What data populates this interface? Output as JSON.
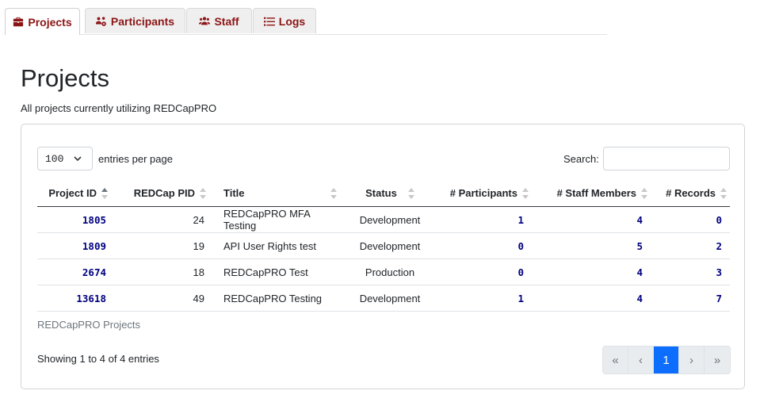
{
  "tabs": [
    {
      "label": "Projects",
      "icon": "briefcase-icon",
      "active": true
    },
    {
      "label": "Participants",
      "icon": "users-cog-icon",
      "active": false
    },
    {
      "label": "Staff",
      "icon": "users-icon",
      "active": false
    },
    {
      "label": "Logs",
      "icon": "list-icon",
      "active": false
    }
  ],
  "page": {
    "title": "Projects",
    "subtitle": "All projects currently utilizing REDCapPRO"
  },
  "table_controls": {
    "length_value": "100",
    "length_label": "entries per page",
    "search_label": "Search:",
    "search_value": ""
  },
  "table": {
    "columns": [
      "Project ID",
      "REDCap PID",
      "Title",
      "Status",
      "# Participants",
      "# Staff Members",
      "# Records"
    ],
    "sorted_column": "Project ID",
    "rows": [
      {
        "project_id": "1805",
        "pid": "24",
        "title": "REDCapPRO MFA Testing",
        "status": "Development",
        "participants": "1",
        "staff": "4",
        "records": "0"
      },
      {
        "project_id": "1809",
        "pid": "19",
        "title": "API User Rights test",
        "status": "Development",
        "participants": "0",
        "staff": "5",
        "records": "2"
      },
      {
        "project_id": "2674",
        "pid": "18",
        "title": "REDCapPRO Test",
        "status": "Production",
        "participants": "0",
        "staff": "4",
        "records": "3"
      },
      {
        "project_id": "13618",
        "pid": "49",
        "title": "REDCapPRO Testing",
        "status": "Development",
        "participants": "1",
        "staff": "4",
        "records": "7"
      }
    ],
    "caption": "REDCapPRO Projects",
    "info": "Showing 1 to 4 of 4 entries"
  },
  "pagination": {
    "first": "«",
    "prev": "‹",
    "current": "1",
    "next": "›",
    "last": "»"
  },
  "colors": {
    "tab_text": "#8c1515",
    "link": "#000080",
    "active_page": "#0d6efd"
  }
}
